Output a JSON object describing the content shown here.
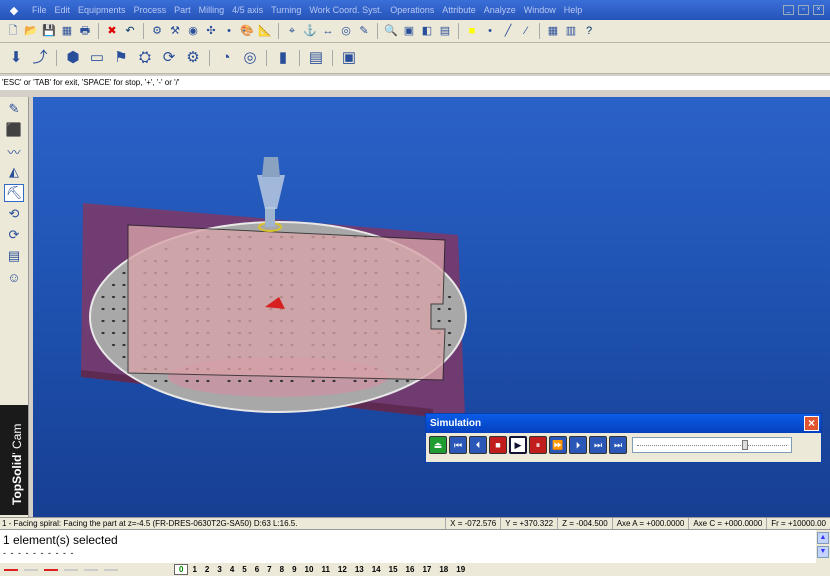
{
  "menu": [
    "File",
    "Edit",
    "Equipments",
    "Process",
    "Part",
    "Milling",
    "4/5 axis",
    "Turning",
    "Work Coord. Syst.",
    "Operations",
    "Attribute",
    "Analyze",
    "Window",
    "Help"
  ],
  "toolbar1": {
    "icons": [
      "new-icon",
      "open-icon",
      "save-icon",
      "calculator-icon",
      "print-icon",
      "delete-icon",
      "undo-icon",
      "tool-icon",
      "machine-icon",
      "cam-icon",
      "axis-icon",
      "point-icon",
      "color-icon",
      "measure-icon",
      "snap-icon",
      "constraint-icon",
      "dimension-icon",
      "hole-icon",
      "sketch-icon",
      "zoom-icon",
      "view-icon",
      "render-icon",
      "display-icon",
      "yellow-color-swatch",
      "point-style-icon",
      "line-style-icon",
      "hatch-icon",
      "property-icon",
      "library-icon",
      "help-icon"
    ]
  },
  "toolbar2": {
    "icons": [
      "drill-icon",
      "path-icon",
      "part-icon",
      "stock-icon",
      "tool-holder-icon",
      "fixture-icon",
      "operation-icon",
      "tooling-icon",
      "simulate-icon",
      "target-icon",
      "post-icon",
      "report-icon",
      "nc-icon"
    ]
  },
  "prompt_text": "'ESC' or 'TAB' for exit, 'SPACE' for stop, '+', '-' or '/'",
  "palette": {
    "active_index": 4,
    "icons": [
      "pencil-icon",
      "cube-icon",
      "curve-icon",
      "surface-icon",
      "milling-icon",
      "turning-icon",
      "operation-icon",
      "document-icon",
      "users-icon"
    ]
  },
  "brand": {
    "bold": "TopSolid",
    "light": "' Cam"
  },
  "simulation": {
    "title": "Simulation",
    "buttons": [
      {
        "name": "eject-button",
        "glyph": "⏏",
        "kind": "green"
      },
      {
        "name": "go-start-button",
        "glyph": "⏮",
        "kind": "blue"
      },
      {
        "name": "step-back-button",
        "glyph": "⏴",
        "kind": "blue"
      },
      {
        "name": "stop-button",
        "glyph": "■",
        "kind": "red"
      },
      {
        "name": "play-button",
        "glyph": "▶",
        "kind": "play"
      },
      {
        "name": "pause-button",
        "glyph": "⏸",
        "kind": "red"
      },
      {
        "name": "fast-forward-button",
        "glyph": "⏩",
        "kind": "blue"
      },
      {
        "name": "step-forward-button",
        "glyph": "⏵",
        "kind": "blue"
      },
      {
        "name": "next-button",
        "glyph": "⏭",
        "kind": "blue"
      },
      {
        "name": "go-end-button",
        "glyph": "⏭",
        "kind": "blue"
      }
    ],
    "slider_position": 0.72
  },
  "info": {
    "operation": "1 - Facing spiral: Facing the part at z=-4.5  (FR-DRES-0630T2G-SA50) D:63 L:16.5.",
    "x": "X = -072.576",
    "y": "Y = +370.322",
    "z": "Z = -004.500",
    "axe_a": "Axe A = +000.0000",
    "axe_c": "Axe C = +000.0000",
    "fr": "Fr = +10000.00"
  },
  "messages": {
    "line1": "1 element(s) selected",
    "line2": "- - - - - - - - - -"
  },
  "layers": {
    "current": "0",
    "numbers": [
      "1",
      "2",
      "3",
      "4",
      "5",
      "6",
      "7",
      "8",
      "9",
      "10",
      "11",
      "12",
      "13",
      "14",
      "15",
      "16",
      "17",
      "18",
      "19"
    ],
    "line_colors": [
      "#e02020",
      "#cccccc",
      "#e02020",
      "#cccccc",
      "#cccccc",
      "#cccccc"
    ]
  },
  "colors": {
    "viewport": "#1f55b5",
    "part": "#d8a3a8",
    "plate": "#a8a8a8",
    "fixture": "#7a3a6a"
  }
}
